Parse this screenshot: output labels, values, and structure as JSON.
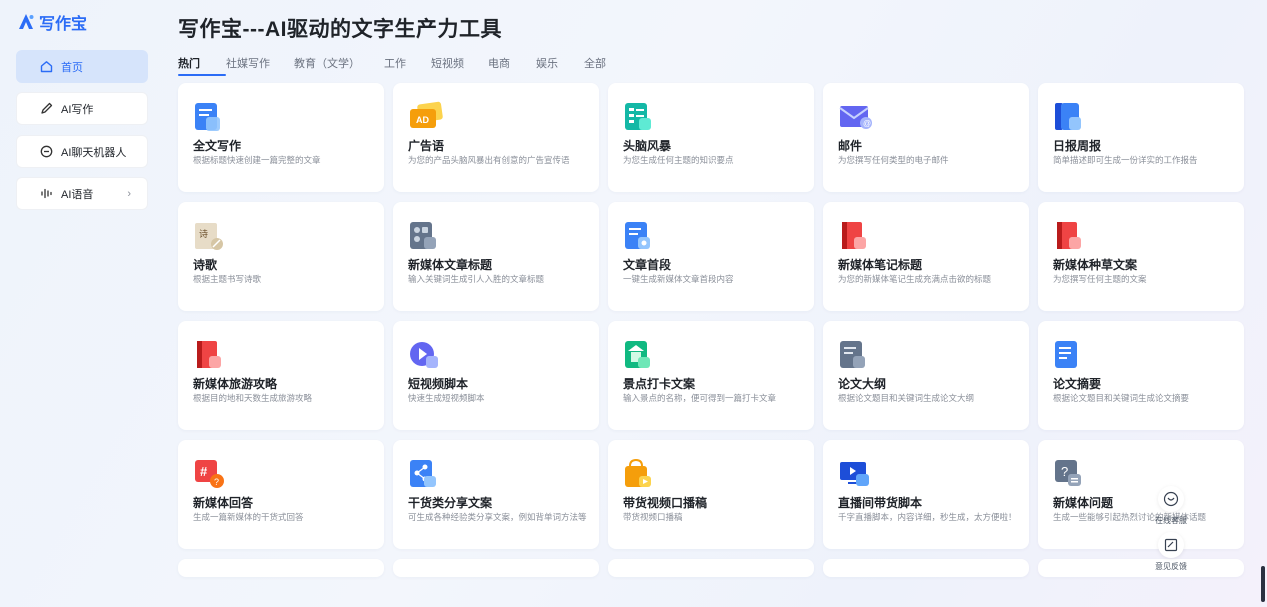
{
  "app": {
    "logo_text": "写作宝",
    "page_title": "写作宝---AI驱动的文字生产力工具"
  },
  "sidebar": {
    "items": [
      {
        "label": "首页",
        "icon": "home-icon"
      },
      {
        "label": "AI写作",
        "icon": "pen-icon"
      },
      {
        "label": "AI聊天机器人",
        "icon": "chat-icon"
      },
      {
        "label": "AI语音",
        "icon": "audio-wave-icon",
        "chevron": "›"
      }
    ]
  },
  "tabs": [
    "热门",
    "社媒写作",
    "教育（文学）",
    "工作",
    "短视频",
    "电商",
    "娱乐",
    "全部"
  ],
  "cards": [
    {
      "title": "全文写作",
      "desc": "根据标题快速创建一篇完整的文章",
      "icon": "document-icon"
    },
    {
      "title": "广告语",
      "desc": "为您的产品头脑风暴出有创意的广告宣传语",
      "icon": "ad-card-icon"
    },
    {
      "title": "头脑风暴",
      "desc": "为您生成任何主题的知识要点",
      "icon": "mindmap-icon"
    },
    {
      "title": "邮件",
      "desc": "为您撰写任何类型的电子邮件",
      "icon": "mail-icon"
    },
    {
      "title": "日报周报",
      "desc": "简单描述即可生成一份详实的工作报告",
      "icon": "report-icon"
    },
    {
      "title": "诗歌",
      "desc": "根据主题书写诗歌",
      "icon": "poem-icon"
    },
    {
      "title": "新媒体文章标题",
      "desc": "输入关键词生成引人入胜的文章标题",
      "icon": "article-title-icon"
    },
    {
      "title": "文章首段",
      "desc": "一键生成新媒体文章首段内容",
      "icon": "first-paragraph-icon"
    },
    {
      "title": "新媒体笔记标题",
      "desc": "为您的新媒体笔记生成充满点击欲的标题",
      "icon": "note-title-icon"
    },
    {
      "title": "新媒体种草文案",
      "desc": "为您撰写任何主题的文案",
      "icon": "seeding-copy-icon"
    },
    {
      "title": "新媒体旅游攻略",
      "desc": "根据目的地和天数生成旅游攻略",
      "icon": "travel-guide-icon"
    },
    {
      "title": "短视频脚本",
      "desc": "快速生成短视频脚本",
      "icon": "video-script-icon"
    },
    {
      "title": "景点打卡文案",
      "desc": "输入景点的名称，便可得到一篇打卡文章",
      "icon": "scenic-spot-icon"
    },
    {
      "title": "论文大纲",
      "desc": "根据论文题目和关键词生成论文大纲",
      "icon": "thesis-outline-icon"
    },
    {
      "title": "论文摘要",
      "desc": "根据论文题目和关键词生成论文摘要",
      "icon": "thesis-abstract-icon"
    },
    {
      "title": "新媒体回答",
      "desc": "生成一篇新媒体的干货式回答",
      "icon": "qa-icon"
    },
    {
      "title": "干货类分享文案",
      "desc": "可生成各种经验类分享文案，例如背单词方法等",
      "icon": "share-icon"
    },
    {
      "title": "带货视频口播稿",
      "desc": "带货视频口播稿",
      "icon": "shopping-video-icon"
    },
    {
      "title": "直播间带货脚本",
      "desc": "千字直播脚本，内容详细，秒生成，太方便啦！",
      "icon": "live-stream-icon"
    },
    {
      "title": "新媒体问题",
      "desc": "生成一些能够引起热烈讨论的新媒体话题",
      "icon": "question-icon"
    }
  ],
  "float": {
    "service_label": "在线客服",
    "feedback_label": "意见反馈"
  },
  "colors": {
    "accent": "#2b6cf6",
    "active_nav_bg": "#d6e4fb"
  }
}
